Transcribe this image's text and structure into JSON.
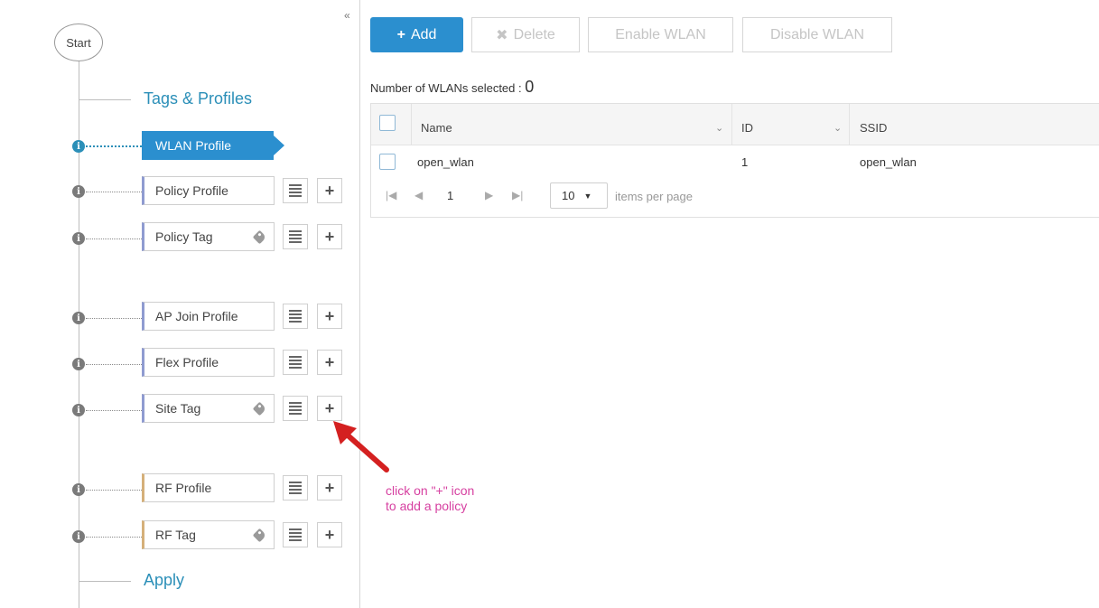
{
  "wizard": {
    "start_label": "Start",
    "sections": {
      "tags_profiles": "Tags & Profiles",
      "apply": "Apply"
    },
    "steps": [
      {
        "label": "WLAN Profile",
        "active": true,
        "has_tag": false
      },
      {
        "label": "Policy Profile",
        "active": false,
        "has_tag": false
      },
      {
        "label": "Policy Tag",
        "active": false,
        "has_tag": true
      },
      {
        "label": "AP Join Profile",
        "active": false,
        "has_tag": false
      },
      {
        "label": "Flex Profile",
        "active": false,
        "has_tag": false
      },
      {
        "label": "Site Tag",
        "active": false,
        "has_tag": true
      },
      {
        "label": "RF Profile",
        "active": false,
        "has_tag": false
      },
      {
        "label": "RF Tag",
        "active": false,
        "has_tag": true
      }
    ],
    "info_glyph": "i",
    "collapse_glyph": "«"
  },
  "toolbar": {
    "add_label": "Add",
    "delete_label": "Delete",
    "enable_label": "Enable WLAN",
    "disable_label": "Disable WLAN"
  },
  "selection": {
    "label": "Number of WLANs selected :",
    "count": "0"
  },
  "grid": {
    "columns": [
      "Name",
      "ID",
      "SSID"
    ],
    "rows": [
      {
        "name": "open_wlan",
        "id": "1",
        "ssid": "open_wlan"
      }
    ],
    "pager": {
      "current_page": "1",
      "page_size": "10",
      "items_per_page_label": "items per page"
    }
  },
  "annotation": {
    "text_line1": "click on \"+\" icon",
    "text_line2": "to add a policy",
    "color": "#d63fa0"
  },
  "colors": {
    "accent": "#2b8fcf",
    "section_text": "#2b8fb8",
    "arrow": "#d42020"
  }
}
